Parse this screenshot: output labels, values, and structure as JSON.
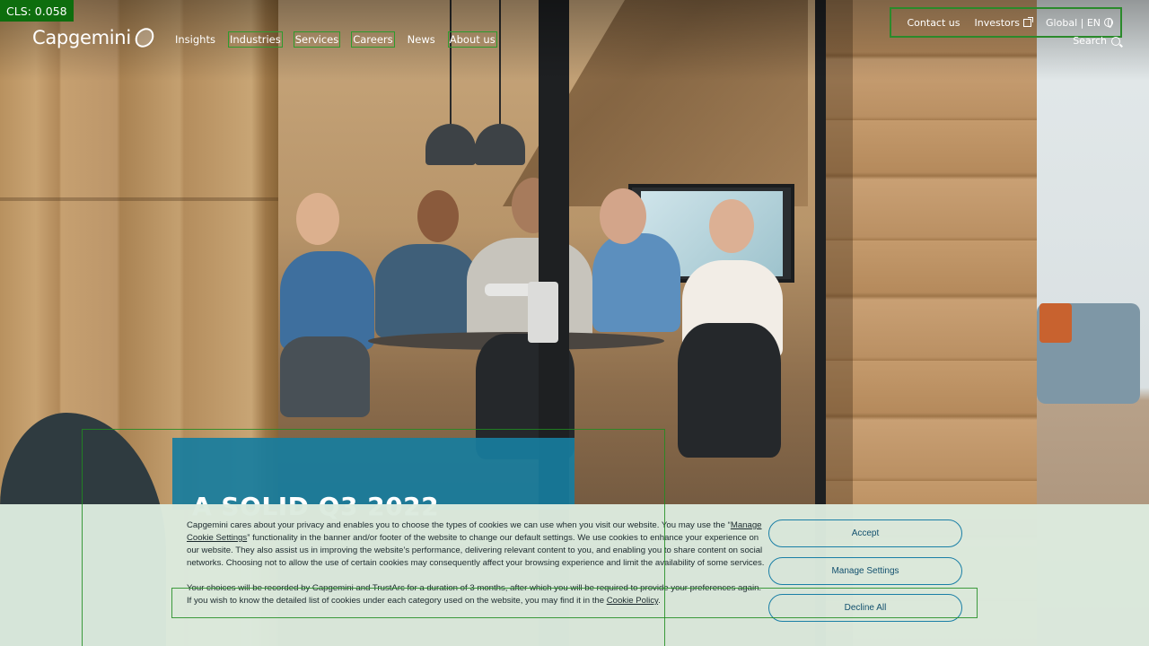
{
  "debug": {
    "cls_label": "CLS: 0.058"
  },
  "brand": {
    "logo_text": "Capgemini"
  },
  "nav": {
    "items": [
      {
        "label": "Insights"
      },
      {
        "label": "Industries"
      },
      {
        "label": "Services"
      },
      {
        "label": "Careers"
      },
      {
        "label": "News"
      },
      {
        "label": "About us"
      }
    ]
  },
  "utility": {
    "contact": "Contact us",
    "investors": "Investors",
    "locale": "Global | EN",
    "search": "Search"
  },
  "hero": {
    "headline": "A SOLID Q3 2022"
  },
  "cookie": {
    "p1_a": "Capgemini cares about your privacy and enables you to choose the types of cookies we can use when you visit our website. You may use the “",
    "p1_link": "Manage Cookie Settings",
    "p1_b": "” functionality in the banner and/or footer of the website to change our default settings. We use cookies to enhance your experience on our website. They also assist us in improving the website’s performance, delivering relevant content to you, and enabling you to share content on social networks. Choosing not to allow the use of certain cookies may consequently affect your browsing experience and limit the availability of some services.",
    "p2_a": "Your choices will be recorded by Capgemini and TrustArc for a duration of 3 months, after which you will be required to provide your preferences again. If you wish to know the detailed list of cookies under each category used on the website, you may find it in the ",
    "p2_link": "Cookie Policy",
    "p2_b": ".",
    "accept": "Accept",
    "manage": "Manage Settings",
    "decline": "Decline All"
  },
  "colors": {
    "accent": "#177d9e",
    "cookie_bg": "#dceade",
    "cls_badge": "#0e6e0e"
  }
}
